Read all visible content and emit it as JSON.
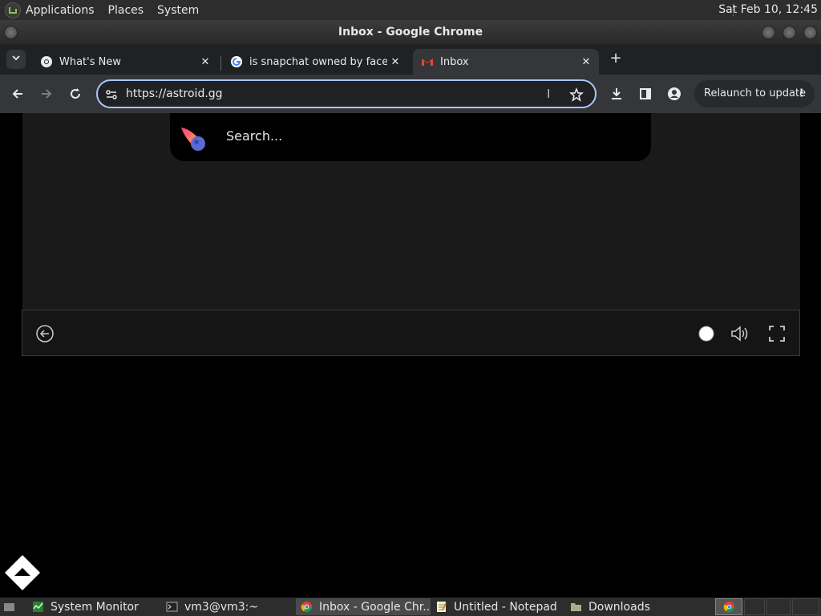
{
  "top_panel": {
    "menus": [
      "Applications",
      "Places",
      "System"
    ],
    "clock": "Sat Feb 10, 12:45"
  },
  "window": {
    "title": "Inbox - Google Chrome"
  },
  "tabs": [
    {
      "label": "What's New",
      "favicon": "chrome-icon"
    },
    {
      "label": "is snapchat owned by facebo",
      "favicon": "google-icon"
    },
    {
      "label": "Inbox",
      "favicon": "gmail-icon"
    }
  ],
  "toolbar": {
    "url": "https://astroid.gg",
    "relaunch_label": "Relaunch to update"
  },
  "page": {
    "search_placeholder": "Search..."
  },
  "taskbar": {
    "items": [
      "System Monitor",
      "vm3@vm3:~",
      "Inbox - Google Chr...",
      "Untitled - Notepad",
      "Downloads"
    ]
  },
  "colors": {
    "accent": "#a8c7fa",
    "tab_strip": "#202124",
    "toolbar": "#35363a",
    "panel": "#2d2d2d"
  }
}
